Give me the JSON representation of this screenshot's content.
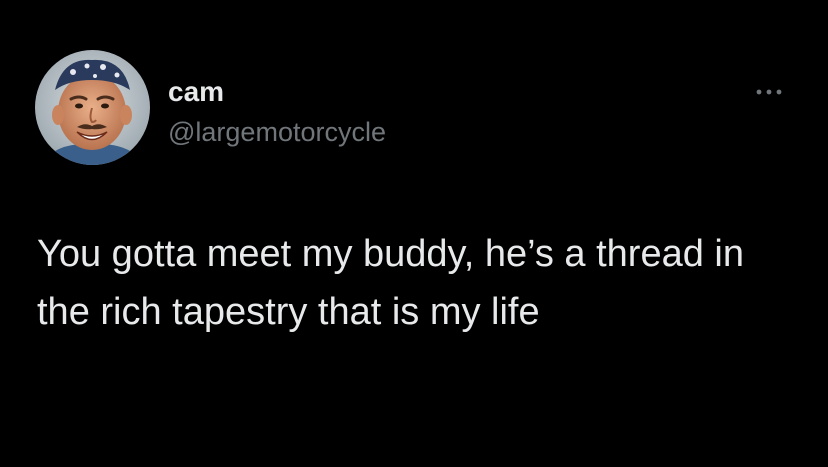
{
  "tweet": {
    "author": {
      "display_name": "cam",
      "handle": "@largemotorcycle",
      "avatar_icon": "profile-photo-avatar"
    },
    "more_icon": "more-options-icon",
    "text": "You gotta meet my buddy, he’s a thread in the rich tapestry that is my life"
  },
  "colors": {
    "background": "#000000",
    "primary_text": "#e7e9ea",
    "secondary_text": "#71767b"
  }
}
